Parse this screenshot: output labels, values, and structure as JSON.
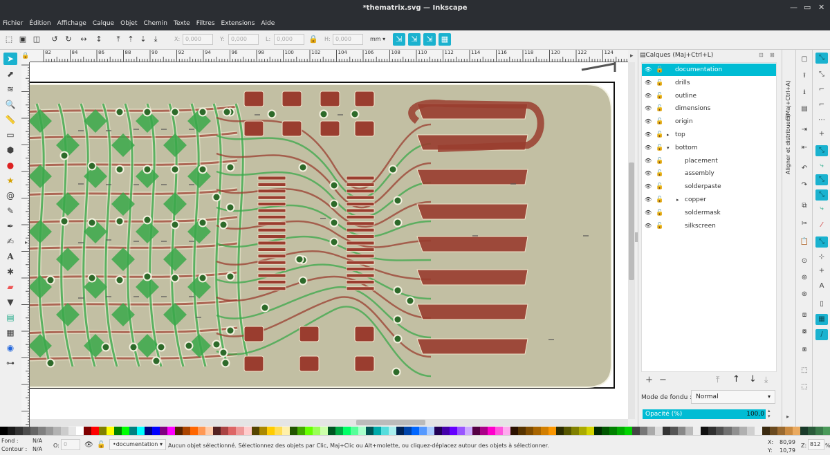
{
  "window": {
    "title": "*thematrix.svg — Inkscape",
    "minimize": "—",
    "restore": "▭",
    "close": "✕"
  },
  "menu": [
    "Fichier",
    "Édition",
    "Affichage",
    "Calque",
    "Objet",
    "Chemin",
    "Texte",
    "Filtres",
    "Extensions",
    "Aide"
  ],
  "toolctl": {
    "x_label": "X:",
    "x_value": "0,000",
    "y_label": "Y:",
    "y_value": "0,000",
    "w_label": "L:",
    "w_value": "0,000",
    "h_label": "H:",
    "h_value": "0,000",
    "unit": "mm"
  },
  "ruler_labels": [
    "82",
    "84",
    "86",
    "88",
    "90",
    "92",
    "94",
    "96",
    "98",
    "100",
    "102",
    "104",
    "106",
    "108",
    "110",
    "112",
    "114",
    "116",
    "118",
    "120",
    "122",
    "124"
  ],
  "panel": {
    "title": "Calques (Maj+Ctrl+L)",
    "side_tab": "Aligner et distribuer (Maj+Ctrl+A)",
    "layers": [
      {
        "name": "documentation",
        "selected": true,
        "indent": 0,
        "arrow": ""
      },
      {
        "name": "drills",
        "selected": false,
        "indent": 0,
        "arrow": ""
      },
      {
        "name": "outline",
        "selected": false,
        "indent": 0,
        "arrow": ""
      },
      {
        "name": "dimensions",
        "selected": false,
        "indent": 0,
        "arrow": ""
      },
      {
        "name": "origin",
        "selected": false,
        "indent": 0,
        "arrow": ""
      },
      {
        "name": "top",
        "selected": false,
        "indent": 0,
        "arrow": "▸"
      },
      {
        "name": "bottom",
        "selected": false,
        "indent": 0,
        "arrow": "▾"
      },
      {
        "name": "placement",
        "selected": false,
        "indent": 1,
        "arrow": ""
      },
      {
        "name": "assembly",
        "selected": false,
        "indent": 1,
        "arrow": ""
      },
      {
        "name": "solderpaste",
        "selected": false,
        "indent": 1,
        "arrow": ""
      },
      {
        "name": "copper",
        "selected": false,
        "indent": 1,
        "arrow": "▸"
      },
      {
        "name": "soldermask",
        "selected": false,
        "indent": 1,
        "arrow": ""
      },
      {
        "name": "silkscreen",
        "selected": false,
        "indent": 1,
        "arrow": ""
      }
    ],
    "blend_label": "Mode de fondu :",
    "blend_value": "Normal",
    "opacity_label": "Opacité (%)",
    "opacity_value": "100,0",
    "add": "+",
    "remove": "−"
  },
  "status": {
    "fill_label": "Fond :",
    "fill_value": "N/A",
    "stroke_label": "Contour :",
    "stroke_value": "N/A",
    "o_label": "O:",
    "o_value": "0",
    "layer_value": "•documentation",
    "message": "Aucun objet sélectionné. Sélectionnez des objets par Clic, Maj+Clic ou Alt+molette, ou cliquez-déplacez autour des objets à sélectionner.",
    "x_label": "X:",
    "x_value": "80,99",
    "y_label": "Y:",
    "y_value": "10,79",
    "z_label": "Z:",
    "zoom_value": "812",
    "zoom_unit": "%"
  },
  "colors": {
    "accent": "#1ab2cf",
    "board": "#c2bfa3",
    "copper_bottom": "#9a3d2f",
    "copper_top": "#3aa84a",
    "via": "#2d6a2a"
  }
}
